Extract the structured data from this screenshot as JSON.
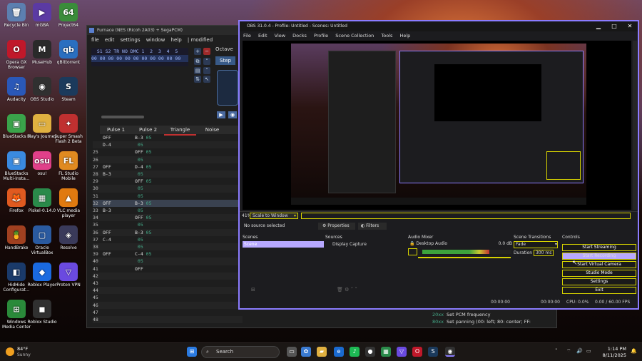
{
  "desktop_icons": [
    {
      "label": "Recycle Bin",
      "icon": "recycle-bin-icon",
      "glyph": "🗑",
      "color": "#5c7fb0"
    },
    {
      "label": "mGBA",
      "icon": "mgba-icon",
      "glyph": "▶",
      "color": "#5b3aa3"
    },
    {
      "label": "Project64",
      "icon": "project64-icon",
      "glyph": "64",
      "color": "#3a8c3a"
    },
    {
      "label": "Opera GX Browser",
      "icon": "opera-gx-icon",
      "glyph": "O",
      "color": "#c0182a"
    },
    {
      "label": "MuseHub",
      "icon": "musehub-icon",
      "glyph": "M",
      "color": "#2a2a2a"
    },
    {
      "label": "qBittorrent",
      "icon": "qbittorrent-icon",
      "glyph": "qb",
      "color": "#2a6fc0"
    },
    {
      "label": "Audacity",
      "icon": "audacity-icon",
      "glyph": "♫",
      "color": "#2a58b8"
    },
    {
      "label": "OBS Studio",
      "icon": "obs-icon",
      "glyph": "◉",
      "color": "#303030"
    },
    {
      "label": "Steam",
      "icon": "steam-icon",
      "glyph": "S",
      "color": "#1b3a5c"
    },
    {
      "label": "BlueStacks 5",
      "icon": "bluestacks-icon",
      "glyph": "▣",
      "color": "#3aa34a"
    },
    {
      "label": "May's Journey",
      "icon": "folder-icon",
      "glyph": "▭",
      "color": "#e0b040"
    },
    {
      "label": "Super Smash Flash 2 Beta",
      "icon": "ssf2-icon",
      "glyph": "✦",
      "color": "#c03030"
    },
    {
      "label": "BlueStacks Multi-Insta...",
      "icon": "bluestacks-multi-icon",
      "glyph": "▣",
      "color": "#3a8ae0"
    },
    {
      "label": "osu!",
      "icon": "osu-icon",
      "glyph": "osu",
      "color": "#e0408a"
    },
    {
      "label": "FL Studio Mobile",
      "icon": "fl-studio-icon",
      "glyph": "FL",
      "color": "#e08a20"
    },
    {
      "label": "Firefox",
      "icon": "firefox-icon",
      "glyph": "🦊",
      "color": "#e05a20"
    },
    {
      "label": "Piskel-0.14.0",
      "icon": "piskel-icon",
      "glyph": "▦",
      "color": "#2a8a4a"
    },
    {
      "label": "VLC media player",
      "icon": "vlc-icon",
      "glyph": "▲",
      "color": "#e07a10"
    },
    {
      "label": "HandBrake",
      "icon": "handbrake-icon",
      "glyph": "🍍",
      "color": "#a04020"
    },
    {
      "label": "Oracle VirtualBox",
      "icon": "virtualbox-icon",
      "glyph": "▢",
      "color": "#2a5aa0"
    },
    {
      "label": "Resolve",
      "icon": "resolve-icon",
      "glyph": "◈",
      "color": "#3a3a5a"
    },
    {
      "label": "HidHide Configurat...",
      "icon": "hidhide-icon",
      "glyph": "◧",
      "color": "#1a3a6a"
    },
    {
      "label": "Roblox Player",
      "icon": "roblox-icon",
      "glyph": "◆",
      "color": "#1a6ae0"
    },
    {
      "label": "Proton VPN",
      "icon": "proton-vpn-icon",
      "glyph": "▽",
      "color": "#6a4ae0"
    },
    {
      "label": "Windows Media Center",
      "icon": "media-center-icon",
      "glyph": "⊞",
      "color": "#2a8a3a"
    },
    {
      "label": "Roblox Studio",
      "icon": "roblox-studio-icon",
      "glyph": "◼",
      "color": "#303030"
    }
  ],
  "furnace": {
    "title": "Furnace (NES (Ricoh 2A03) + SegaPCM)",
    "menu": [
      "file",
      "edit",
      "settings",
      "window",
      "help",
      "| modified"
    ],
    "ins_header": "  S1 S2 TR NO DMC 1  2  3  4  5",
    "ins_values": "00 00 00 00 00 00 00 00 00 00 00",
    "octave_label": "Octave",
    "step_label": "Step",
    "channels": [
      "Pulse 1",
      "Pulse 2",
      "Triangle",
      "Noise"
    ],
    "rows": [
      {
        "n": "",
        "c1": "OFF",
        "c2": "B-3",
        "v2": "05"
      },
      {
        "n": "",
        "c1": "D-4",
        "c2": "",
        "v2": "05"
      },
      {
        "n": "25",
        "c1": "",
        "c2": "OFF",
        "v2": "05"
      },
      {
        "n": "26",
        "c1": "",
        "c2": "",
        "v2": "05"
      },
      {
        "n": "27",
        "c1": "OFF",
        "c2": "D-4",
        "v2": "05"
      },
      {
        "n": "28",
        "c1": "B-3",
        "c2": "",
        "v2": "05"
      },
      {
        "n": "29",
        "c1": "",
        "c2": "OFF",
        "v2": "05"
      },
      {
        "n": "30",
        "c1": "",
        "c2": "",
        "v2": "05"
      },
      {
        "n": "31",
        "c1": "",
        "c2": "",
        "v2": "05"
      },
      {
        "n": "32",
        "c1": "OFF",
        "c2": "B-3",
        "v2": "05"
      },
      {
        "n": "33",
        "c1": "B-3",
        "c2": "",
        "v2": "05"
      },
      {
        "n": "34",
        "c1": "",
        "c2": "OFF",
        "v2": "05"
      },
      {
        "n": "35",
        "c1": "",
        "c2": "",
        "v2": "05"
      },
      {
        "n": "36",
        "c1": "OFF",
        "c2": "B-3",
        "v2": "05"
      },
      {
        "n": "37",
        "c1": "C-4",
        "c2": "",
        "v2": "05"
      },
      {
        "n": "38",
        "c1": "",
        "c2": "",
        "v2": "05"
      },
      {
        "n": "39",
        "c1": "OFF",
        "c2": "C-4",
        "v2": "05"
      },
      {
        "n": "40",
        "c1": "",
        "c2": "",
        "v2": "05"
      },
      {
        "n": "41",
        "c1": "",
        "c2": "OFF",
        "v2": ""
      },
      {
        "n": "42",
        "c1": "",
        "c2": "",
        "v2": ""
      },
      {
        "n": "43",
        "c1": "",
        "c2": "",
        "v2": ""
      },
      {
        "n": "44",
        "c1": "",
        "c2": "",
        "v2": ""
      },
      {
        "n": "45",
        "c1": "",
        "c2": "",
        "v2": ""
      },
      {
        "n": "46",
        "c1": "",
        "c2": "",
        "v2": ""
      },
      {
        "n": "47",
        "c1": "",
        "c2": "",
        "v2": ""
      },
      {
        "n": "48",
        "c1": "",
        "c2": "",
        "v2": ""
      }
    ],
    "effects": [
      {
        "code": "20xx",
        "text": "Set PCM frequency"
      },
      {
        "code": "80xx",
        "text": "Set panning (00: left; 80: center; FF:"
      }
    ]
  },
  "obs": {
    "title": "OBS 31.0.4 - Profile: Untitled - Scenes: Untitled",
    "menu": [
      "File",
      "Edit",
      "View",
      "Docks",
      "Profile",
      "Scene Collection",
      "Tools",
      "Help"
    ],
    "zoom": "41%",
    "scale_mode": "Scale to Window",
    "no_source": "No source selected",
    "properties": "Properties",
    "filters": "Filters",
    "docks": {
      "scenes": "Scenes",
      "sources": "Sources",
      "mixer": "Audio Mixer",
      "transitions": "Scene Transitions",
      "controls": "Controls"
    },
    "scene_item": "Scene",
    "source_item": "Display Capture",
    "mixer_item": "Desktop Audio",
    "mixer_db": "0.0 dB",
    "mixer_level": 0.75,
    "transition": "Fade",
    "duration_label": "Duration",
    "duration": "300 ms",
    "controls": [
      "Start Streaming",
      "Start Recording",
      "Start Virtual Camera",
      "Studio Mode",
      "Settings",
      "Exit"
    ],
    "status": {
      "rec_time": "00:00:00",
      "stream_time": "00:00:00",
      "cpu": "CPU: 0.0%",
      "fps": "0.00 / 60.00 FPS"
    }
  },
  "taskbar": {
    "weather_temp": "84°F",
    "weather_desc": "Sunny",
    "search": "Search",
    "time": "1:14 PM",
    "date": "8/11/2025"
  },
  "colors": {
    "accent": "#8b7cff",
    "obs_yellow": "#d6d200",
    "meter_green": "#3ca33c"
  }
}
